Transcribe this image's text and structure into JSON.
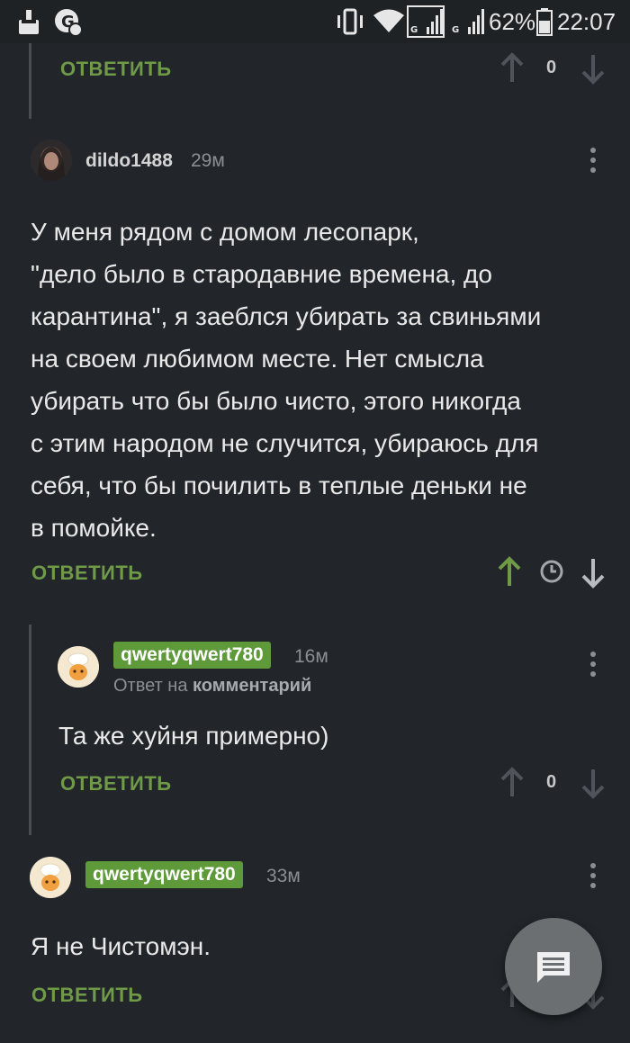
{
  "status_bar": {
    "battery_percent": "62%",
    "time": "22:07",
    "battery_level": 0.62
  },
  "labels": {
    "reply": "ОТВЕТИТЬ",
    "answer_on_prefix": "Ответ на",
    "answer_on_target": "комментарий"
  },
  "top_stub": {
    "rating": "0"
  },
  "comment1": {
    "username": "dildo1488",
    "time": "29м",
    "text_lines": [
      "У меня рядом с домом лесопарк,",
      "\"дело было в стародавние времена, до",
      "карантина\", я заеблся убирать за свиньями",
      "на своем любимом месте. Нет смысла",
      "убирать что бы было чисто, этого никогда",
      "с этим народом не случится, убираюсь для",
      "себя, что бы почилить в теплые деньки не",
      "в помойке."
    ]
  },
  "comment2": {
    "username": "qwertyqwert780",
    "time": "16м",
    "text": "Та же хуйня примерно)",
    "rating": "0"
  },
  "comment3": {
    "username": "qwertyqwert780",
    "time": "33м",
    "text": "Я не Чистомэн."
  },
  "colors": {
    "background": "#22262a",
    "accent_green": "#6f9a47",
    "badge_green": "#5f9a3a"
  }
}
